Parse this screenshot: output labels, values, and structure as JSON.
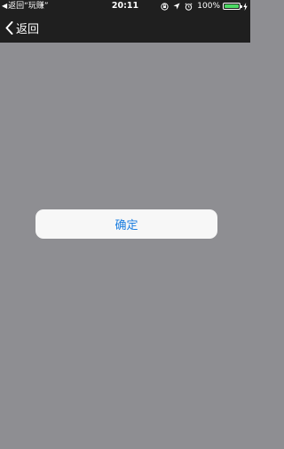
{
  "status_bar": {
    "back_app": "返回“玩赚”",
    "time": "20:11",
    "battery_percent": "100%",
    "battery_level": 1.0,
    "icons": [
      "orientation-lock-icon",
      "location-icon",
      "alarm-icon",
      "battery-icon",
      "charging-icon"
    ]
  },
  "nav": {
    "back_label": "返回"
  },
  "dialog": {
    "confirm_label": "确定"
  },
  "colors": {
    "bar_background": "#1f1f1f",
    "overlay_background": "#8e8e92",
    "button_background": "#f7f7f7",
    "accent_blue": "#1a7de0",
    "battery_green": "#4cd964"
  }
}
